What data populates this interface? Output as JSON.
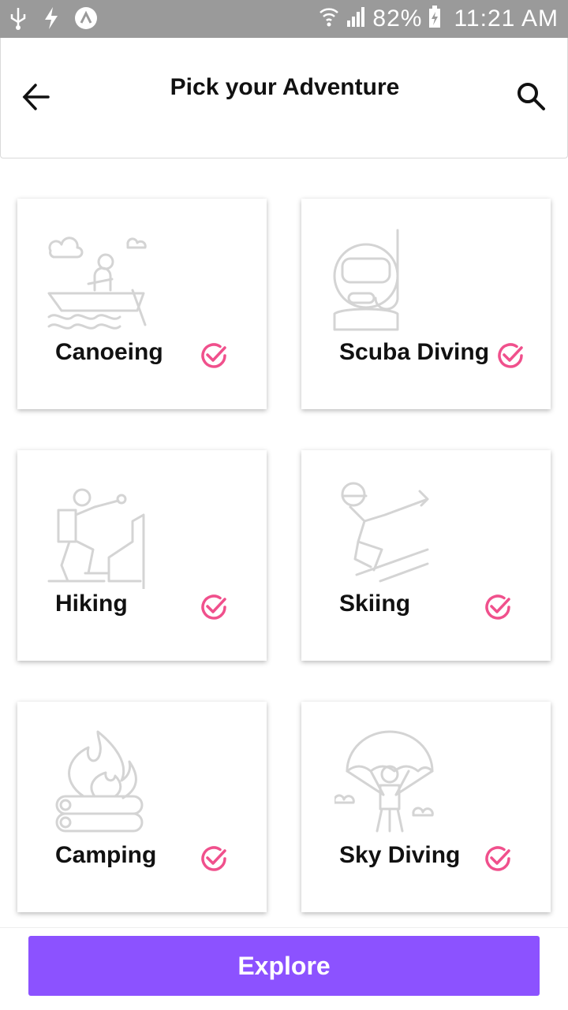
{
  "status_bar": {
    "battery_percent": "82%",
    "time": "11:21 AM"
  },
  "header": {
    "title": "Pick your Adventure",
    "back_icon": "arrow-left-icon",
    "search_icon": "search-icon"
  },
  "activities": [
    {
      "label": "Canoeing",
      "icon": "canoe-icon",
      "selected": true
    },
    {
      "label": "Scuba Diving",
      "icon": "scuba-diver-icon",
      "selected": true
    },
    {
      "label": "Hiking",
      "icon": "hiker-icon",
      "selected": true
    },
    {
      "label": "Skiing",
      "icon": "skier-icon",
      "selected": true
    },
    {
      "label": "Camping",
      "icon": "campfire-icon",
      "selected": true
    },
    {
      "label": "Sky Diving",
      "icon": "parachute-icon",
      "selected": true
    }
  ],
  "colors": {
    "accent": "#8c52ff",
    "check": "#f0508c",
    "illustration": "#d4d4d4"
  },
  "footer": {
    "explore_label": "Explore"
  }
}
